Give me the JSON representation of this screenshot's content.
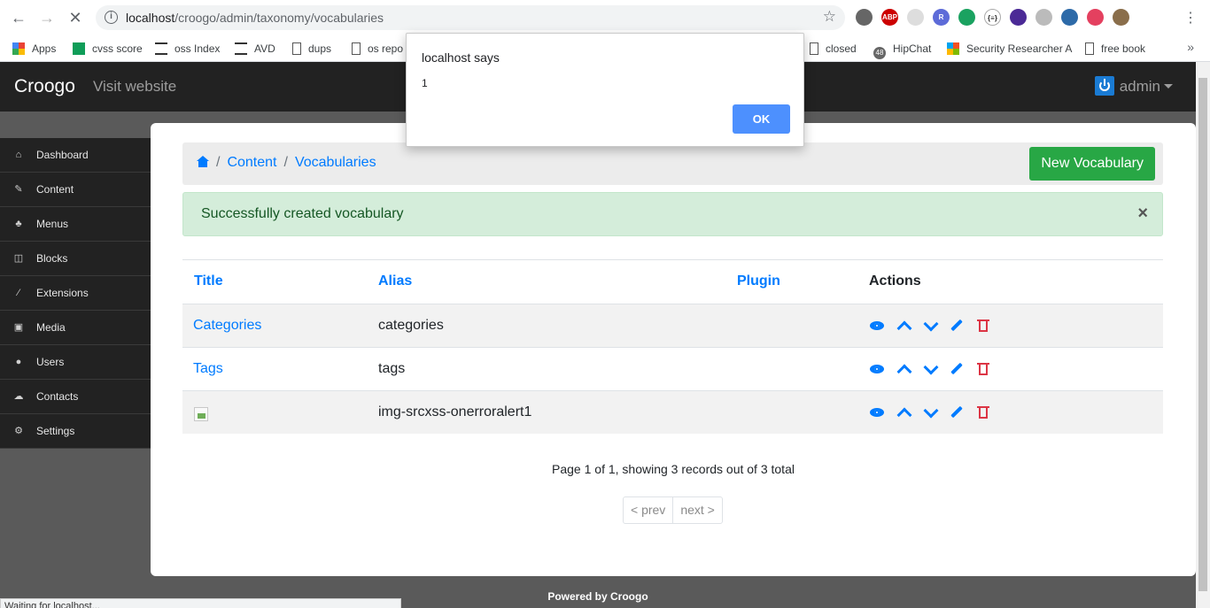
{
  "browser": {
    "url_host": "localhost",
    "url_path": "/croogo/admin/taxonomy/vocabularies",
    "bookmarks": [
      "Apps",
      "cvss score",
      "oss Index",
      "AVD",
      "dups",
      "os repo",
      "closed",
      "HipChat",
      "Security Researcher A",
      "free book"
    ],
    "hipchat_badge": "48",
    "status_text": "Waiting for localhost..."
  },
  "dialog": {
    "title": "localhost says",
    "message": "1",
    "ok_label": "OK"
  },
  "header": {
    "brand": "Croogo",
    "visit_link": "Visit website",
    "user": "admin"
  },
  "sidebar": {
    "items": [
      {
        "label": "Dashboard",
        "icon": "dashboard-icon"
      },
      {
        "label": "Content",
        "icon": "edit-icon"
      },
      {
        "label": "Menus",
        "icon": "sitemap-icon"
      },
      {
        "label": "Blocks",
        "icon": "columns-icon"
      },
      {
        "label": "Extensions",
        "icon": "magic-icon"
      },
      {
        "label": "Media",
        "icon": "picture-icon"
      },
      {
        "label": "Users",
        "icon": "user-icon"
      },
      {
        "label": "Contacts",
        "icon": "comments-icon"
      },
      {
        "label": "Settings",
        "icon": "gear-icon"
      }
    ]
  },
  "breadcrumb": {
    "items": [
      "Content",
      "Vocabularies"
    ],
    "new_button": "New Vocabulary"
  },
  "alert": {
    "message": "Successfully created vocabulary",
    "close": "×"
  },
  "table": {
    "headers": {
      "title": "Title",
      "alias": "Alias",
      "plugin": "Plugin",
      "actions": "Actions"
    },
    "rows": [
      {
        "title": "Categories",
        "alias": "categories",
        "plugin": ""
      },
      {
        "title": "Tags",
        "alias": "tags",
        "plugin": ""
      },
      {
        "title": "",
        "alias": "img-srcxss-onerroralert1",
        "plugin": ""
      }
    ]
  },
  "pagination": {
    "summary": "Page 1 of 1, showing 3 records out of 3 total",
    "prev": "< prev",
    "next": "next >"
  },
  "footer": {
    "text": "Powered by Croogo"
  },
  "colors": {
    "primary": "#007bff",
    "success": "#28a745",
    "danger": "#dc3545",
    "navbar": "#222222"
  }
}
